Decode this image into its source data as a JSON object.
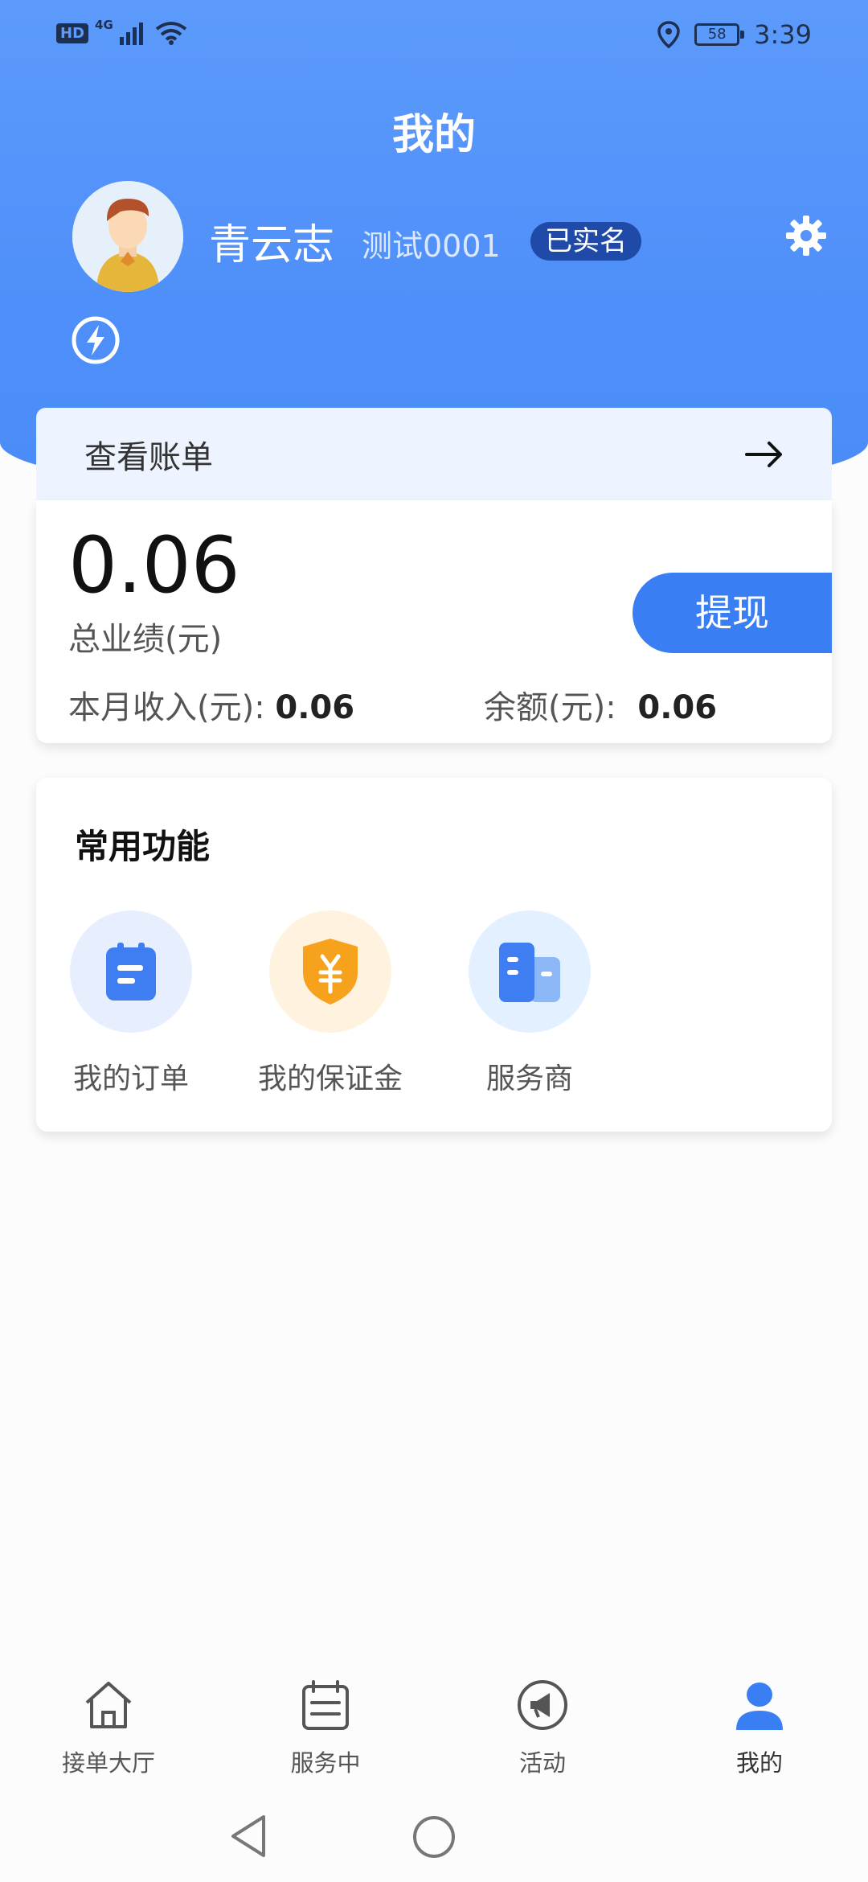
{
  "status_bar": {
    "hd": "HD",
    "network": "4G",
    "battery": "58",
    "time": "3:39"
  },
  "header": {
    "title": "我的"
  },
  "user": {
    "name": "青云志",
    "id": "测试0001",
    "verified_label": "已实名"
  },
  "bill": {
    "label": "查看账单"
  },
  "stats": {
    "total_value": "0.06",
    "total_label": "总业绩(元)",
    "withdraw_label": "提现",
    "month_income_label": "本月收入(元):",
    "month_income_value": "0.06",
    "balance_label": "余额(元):",
    "balance_value": "0.06"
  },
  "functions": {
    "title": "常用功能",
    "items": [
      {
        "label": "我的订单",
        "icon": "order-icon"
      },
      {
        "label": "我的保证金",
        "icon": "deposit-shield-icon"
      },
      {
        "label": "服务商",
        "icon": "building-icon"
      }
    ]
  },
  "tabs": [
    {
      "label": "接单大厅",
      "icon": "home-icon"
    },
    {
      "label": "服务中",
      "icon": "list-icon"
    },
    {
      "label": "活动",
      "icon": "megaphone-icon"
    },
    {
      "label": "我的",
      "icon": "person-icon",
      "active": true
    }
  ],
  "colors": {
    "primary": "#3a7ef3",
    "hero": "#5c9bfb",
    "verified_badge": "#1f4aa8",
    "deposit_orange": "#f7a21d"
  }
}
